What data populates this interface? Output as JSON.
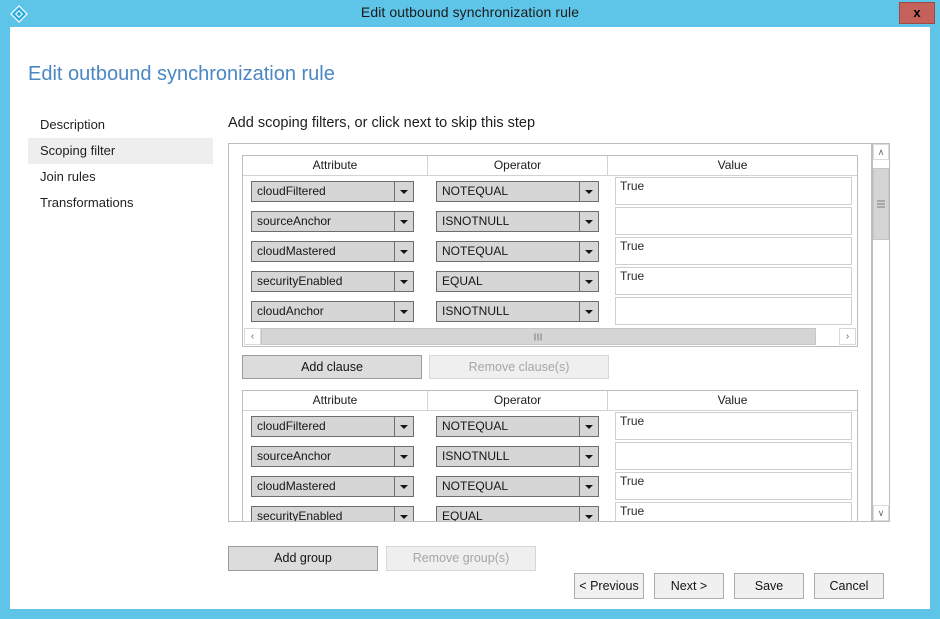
{
  "window": {
    "title": "Edit outbound synchronization rule",
    "icon": "diamond-icon",
    "close_label": "x",
    "titlebar_color": "#5ec5e8",
    "close_color": "#c4615a"
  },
  "page": {
    "heading": "Edit outbound synchronization rule",
    "heading_color": "#4a87c4"
  },
  "sidebar": {
    "items": [
      {
        "label": "Description",
        "selected": false
      },
      {
        "label": "Scoping filter",
        "selected": true
      },
      {
        "label": "Join rules",
        "selected": false
      },
      {
        "label": "Transformations",
        "selected": false
      }
    ]
  },
  "main": {
    "instruction": "Add scoping filters, or click next to skip this step",
    "columns": [
      "Attribute",
      "Operator",
      "Value"
    ],
    "groups": [
      {
        "rows": [
          {
            "attribute": "cloudFiltered",
            "operator": "NOTEQUAL",
            "value": "True"
          },
          {
            "attribute": "sourceAnchor",
            "operator": "ISNOTNULL",
            "value": ""
          },
          {
            "attribute": "cloudMastered",
            "operator": "NOTEQUAL",
            "value": "True"
          },
          {
            "attribute": "securityEnabled",
            "operator": "EQUAL",
            "value": "True"
          },
          {
            "attribute": "cloudAnchor",
            "operator": "ISNOTNULL",
            "value": ""
          }
        ],
        "has_hscroll": true
      },
      {
        "rows": [
          {
            "attribute": "cloudFiltered",
            "operator": "NOTEQUAL",
            "value": "True"
          },
          {
            "attribute": "sourceAnchor",
            "operator": "ISNOTNULL",
            "value": ""
          },
          {
            "attribute": "cloudMastered",
            "operator": "NOTEQUAL",
            "value": "True"
          },
          {
            "attribute": "securityEnabled",
            "operator": "EQUAL",
            "value": "True"
          },
          {
            "attribute": "",
            "operator": "",
            "value": ""
          }
        ],
        "has_hscroll": false
      }
    ],
    "clause_buttons": {
      "add": "Add clause",
      "remove": "Remove clause(s)",
      "remove_disabled": true
    },
    "group_buttons": {
      "add": "Add group",
      "remove": "Remove group(s)",
      "remove_disabled": true
    },
    "scrollbars": {
      "left_arrow": "‹",
      "right_arrow": "›",
      "up_arrow": "∧",
      "down_arrow": "∨"
    }
  },
  "footer": {
    "buttons": [
      {
        "label": "< Previous"
      },
      {
        "label": "Next >"
      },
      {
        "label": "Save"
      },
      {
        "label": "Cancel"
      }
    ]
  }
}
